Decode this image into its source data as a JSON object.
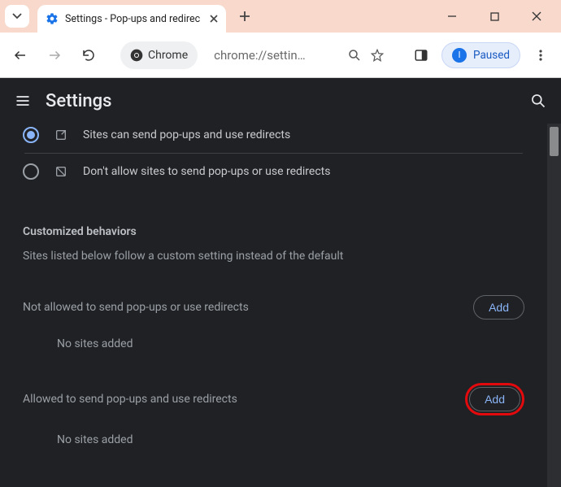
{
  "window": {
    "tab_title": "Settings - Pop-ups and redirec"
  },
  "toolbar": {
    "chrome_label": "Chrome",
    "url_display": "chrome://settin…",
    "paused_label": "Paused",
    "paused_initial": "I"
  },
  "page": {
    "title": "Settings",
    "radios": {
      "allow_label": "Sites can send pop-ups and use redirects",
      "block_label": "Don't allow sites to send pop-ups or use redirects"
    },
    "custom": {
      "heading": "Customized behaviors",
      "subtitle": "Sites listed below follow a custom setting instead of the default"
    },
    "block_list": {
      "header": "Not allowed to send pop-ups or use redirects",
      "add_label": "Add",
      "empty": "No sites added"
    },
    "allow_list": {
      "header": "Allowed to send pop-ups and use redirects",
      "add_label": "Add",
      "empty": "No sites added"
    }
  }
}
